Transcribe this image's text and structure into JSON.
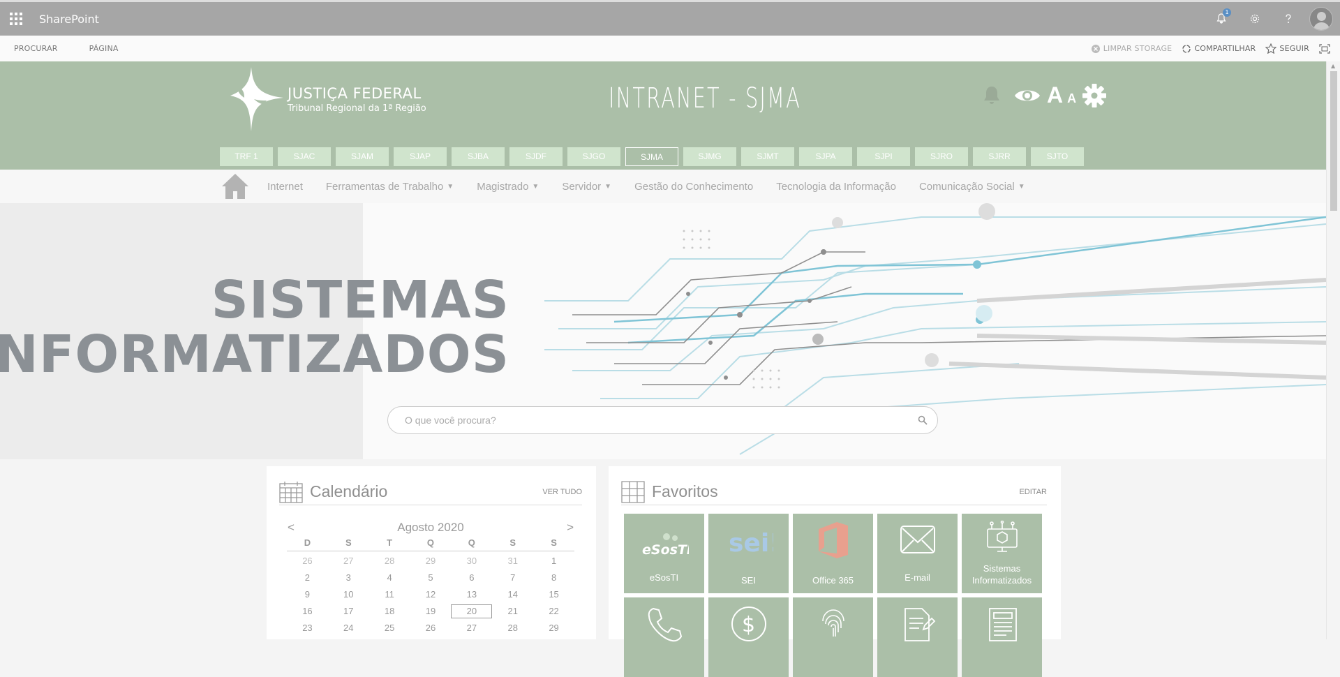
{
  "suitebar": {
    "title": "SharePoint",
    "notification_count": "1"
  },
  "ribbon": {
    "left": [
      "PROCURAR",
      "PÁGINA"
    ],
    "clear_storage": "LIMPAR STORAGE",
    "share": "COMPARTILHAR",
    "follow": "SEGUIR"
  },
  "header": {
    "logo_line1": "JUSTIÇA FEDERAL",
    "logo_line2": "Tribunal Regional da 1ª Região",
    "site_title": "INTRANET - SJMA",
    "font_big": "A",
    "font_small": "A",
    "tabs": [
      "TRF 1",
      "SJAC",
      "SJAM",
      "SJAP",
      "SJBA",
      "SJDF",
      "SJGO",
      "SJMA",
      "SJMG",
      "SJMT",
      "SJPA",
      "SJPI",
      "SJRO",
      "SJRR",
      "SJTO"
    ],
    "active_tab": "SJMA"
  },
  "nav": {
    "items": [
      {
        "label": "Internet",
        "dropdown": false
      },
      {
        "label": "Ferramentas de Trabalho",
        "dropdown": true
      },
      {
        "label": "Magistrado",
        "dropdown": true
      },
      {
        "label": "Servidor",
        "dropdown": true
      },
      {
        "label": "Gestão do Conhecimento",
        "dropdown": false
      },
      {
        "label": "Tecnologia da Informação",
        "dropdown": false
      },
      {
        "label": "Comunicação Social",
        "dropdown": true
      }
    ]
  },
  "hero": {
    "line1": "SISTEMAS",
    "line2": "INFORMATIZADOS",
    "search_placeholder": "O que você procura?"
  },
  "calendar": {
    "title": "Calendário",
    "link": "VER TUDO",
    "prev": "<",
    "next": ">",
    "month": "Agosto 2020",
    "weekdays": [
      "D",
      "S",
      "T",
      "Q",
      "Q",
      "S",
      "S"
    ],
    "weeks": [
      [
        "26",
        "27",
        "28",
        "29",
        "30",
        "31",
        "1"
      ],
      [
        "2",
        "3",
        "4",
        "5",
        "6",
        "7",
        "8"
      ],
      [
        "9",
        "10",
        "11",
        "12",
        "13",
        "14",
        "15"
      ],
      [
        "16",
        "17",
        "18",
        "19",
        "20",
        "21",
        "22"
      ],
      [
        "23",
        "24",
        "25",
        "26",
        "27",
        "28",
        "29"
      ]
    ],
    "today": "20"
  },
  "favorites": {
    "title": "Favoritos",
    "link": "EDITAR",
    "tiles": [
      {
        "label": "eSosTI",
        "icon": "esosti-logo"
      },
      {
        "label": "SEI",
        "icon": "sei-logo"
      },
      {
        "label": "Office 365",
        "icon": "office-logo"
      },
      {
        "label": "E-mail",
        "icon": "envelope-icon"
      },
      {
        "label": "Sistemas Informatizados",
        "icon": "systems-icon"
      },
      {
        "label": "",
        "icon": "phone-icon"
      },
      {
        "label": "",
        "icon": "dollar-icon"
      },
      {
        "label": "",
        "icon": "fingerprint-icon"
      },
      {
        "label": "",
        "icon": "document-icon"
      },
      {
        "label": "",
        "icon": "newspaper-icon"
      }
    ],
    "esosti_text": "eSosTI",
    "sei_text": "sei!"
  },
  "colors": {
    "header_green": "#abbfa8",
    "tab_green": "#d0e4cd",
    "suitebar": "#a6a6a6"
  }
}
